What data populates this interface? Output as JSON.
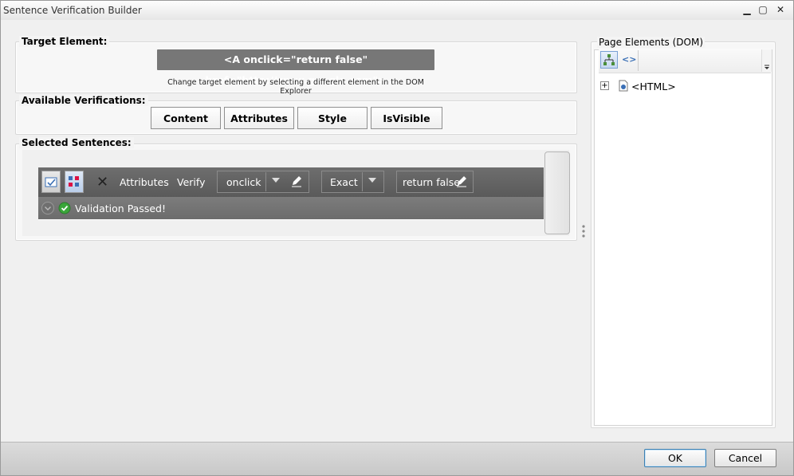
{
  "window": {
    "title": "Sentence Verification Builder",
    "minimize": "▁",
    "maximize": "▢",
    "close": "✕"
  },
  "target": {
    "label": "Target Element:",
    "element_text": "<A onclick=\"return false\" href=\"http://www.google.com\">",
    "hint": "Change target element by selecting a different element in the DOM Explorer"
  },
  "verifications": {
    "label": "Available Verifications:",
    "buttons": [
      "Content",
      "Attributes",
      "Style",
      "IsVisible"
    ]
  },
  "sentences": {
    "label": "Selected Sentences:",
    "row": {
      "remove_glyph": "✕",
      "category": "Attributes",
      "verb": "Verify",
      "attribute": "onclick",
      "compare": "Exact",
      "value": "return false",
      "status": "Validation Passed!"
    }
  },
  "dom": {
    "label": "Page Elements (DOM)",
    "tree_toggle": "+",
    "root_node": "<HTML>",
    "view_toggle_glyph": "<>"
  },
  "footer": {
    "ok": "OK",
    "cancel": "Cancel"
  },
  "colors": {
    "bar": "#5f5f5f",
    "success": "#3aa63a"
  }
}
